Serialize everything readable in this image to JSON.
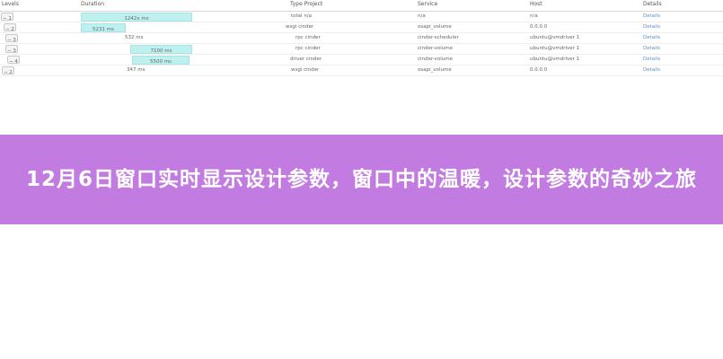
{
  "table": {
    "headers": {
      "levels": "Levels",
      "duration": "Duration",
      "type_project": "Type Project",
      "service": "Service",
      "host": "Host",
      "details": "Details"
    },
    "rows": [
      {
        "level": "− 1",
        "duration": "1242x ms",
        "type": "total n/a",
        "service": "n/a",
        "host": "n/a",
        "details": "Details"
      },
      {
        "level": "− 2",
        "duration": "5231 ms",
        "type": "wsgi cinder",
        "service": "osapi_volume",
        "host": "0.0.0.0",
        "details": "Details"
      },
      {
        "level": "− 3",
        "duration": "532 ms",
        "type": "rpc cinder",
        "service": "cinder-scheduler",
        "host": "ubuntu@vmdriver 1",
        "details": "Details"
      },
      {
        "level": "− 3",
        "duration": "7100 ms",
        "type": "rpc cinder",
        "service": "cinder-volume",
        "host": "ubuntu@vmdriver 1",
        "details": "Details"
      },
      {
        "level": "− 4",
        "duration": "5500 ms",
        "type": "driver cinder",
        "service": "cinder-volume",
        "host": "ubuntu@vmdriver 1",
        "details": "Details"
      },
      {
        "level": "− 2",
        "duration": "347 ms",
        "type": "wsgi cinder",
        "service": "osapi_volume",
        "host": "0.0.0.0",
        "details": "Details"
      }
    ]
  },
  "banner": {
    "title": "12月6日窗口实时显示设计参数，窗口中的温暖，设计参数的奇妙之旅"
  },
  "colors": {
    "banner_bg": "#c27be1",
    "bar_fill": "#bff0f0",
    "details_link": "#5c8fc8"
  }
}
